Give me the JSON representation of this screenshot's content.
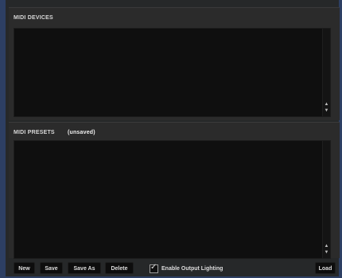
{
  "devices_panel": {
    "title": "MIDI DEVICES",
    "scroll_up_glyph": "▲",
    "scroll_down_glyph": "▼"
  },
  "presets_panel": {
    "title": "MIDI PRESETS",
    "status": "(unsaved)",
    "scroll_up_glyph": "▲",
    "scroll_down_glyph": "▼"
  },
  "toolbar": {
    "new_label": "New",
    "save_label": "Save",
    "save_as_label": "Save As",
    "delete_label": "Delete",
    "enable_output_lighting_label": "Enable Output Lighting",
    "enable_output_lighting_checked": true,
    "check_glyph": "✓",
    "load_label": "Load"
  },
  "colors": {
    "window_edge": "#2d3f63",
    "panel_bg": "#2b2b2b",
    "list_bg": "#0f0f0f",
    "button_bg": "#0d0d0d",
    "text": "#dcdcdc"
  }
}
